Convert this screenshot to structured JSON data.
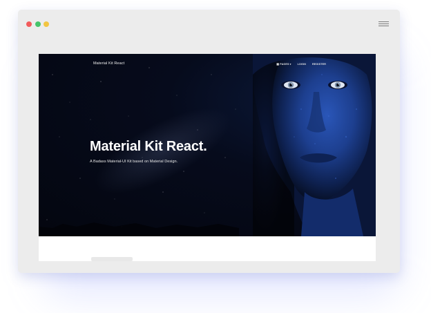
{
  "browser": {
    "menu_icon": "hamburger-menu-icon",
    "traffic_lights": [
      "red",
      "green",
      "yellow"
    ]
  },
  "site": {
    "brand": "Material Kit React",
    "nav": [
      {
        "label": "PAGES",
        "icon": "grid-icon",
        "dropdown": true
      },
      {
        "label": "LOGIN"
      },
      {
        "label": "REGISTER"
      }
    ]
  },
  "hero": {
    "title": "Material Kit React.",
    "subtitle": "A Badass Material-UI Kit based on Material Design."
  },
  "colors": {
    "hero_bg": "#060b1c",
    "face_blue": "#1d3f8f",
    "window_frame": "#ececec"
  }
}
